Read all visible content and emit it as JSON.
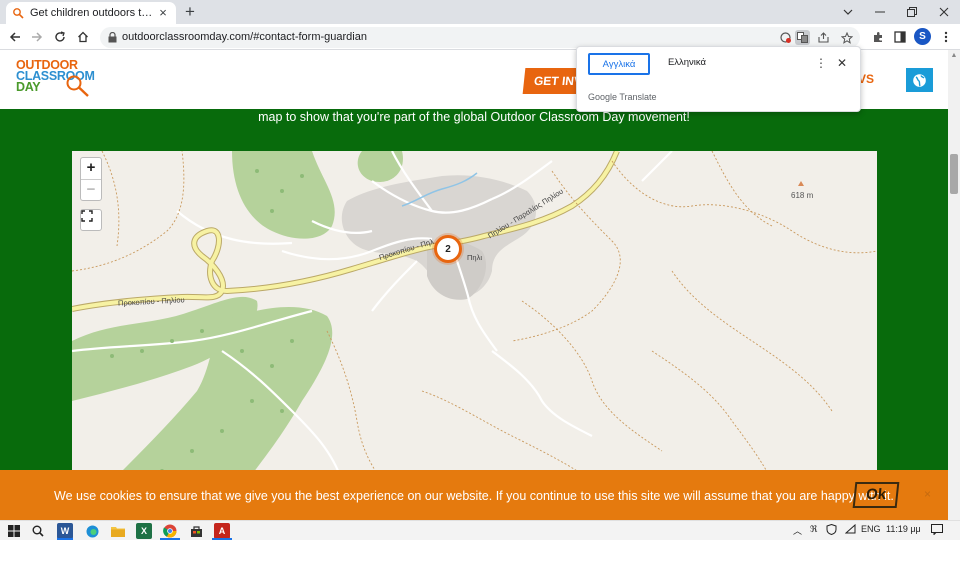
{
  "browser": {
    "tab_title": "Get children outdoors to play an",
    "url": "outdoorclassroomday.com/#contact-form-guardian",
    "profile_initial": "S"
  },
  "translate": {
    "lang_active": "Αγγλικά",
    "lang_other": "Ελληνικά",
    "brand": "Google Translate"
  },
  "site": {
    "logo": {
      "line1": "OUTDOOR",
      "line2": "CLASSROOM",
      "line3": "DAY"
    },
    "get_involved": "GET INVO",
    "news": "VS"
  },
  "intro_text": "map to show that you're part of the global Outdoor Classroom Day movement!",
  "map": {
    "zoom_in": "+",
    "zoom_out": "−",
    "cluster_count": "2",
    "peak": "618 m",
    "village": "Πηλι",
    "road_1": "Προκοπίου - Πηλίου",
    "road_2": "Προκοπίου - Πηλ",
    "road_3": "Πηλίου - Παραλίας Πηλίου"
  },
  "cookie": {
    "text": "We use cookies to ensure that we give you the best experience on our website. If you continue to use this site we will assume that you are happy with it.",
    "ok": "Ok",
    "close": "×"
  },
  "taskbar": {
    "lang": "ENG",
    "time": "11:19 μμ"
  }
}
